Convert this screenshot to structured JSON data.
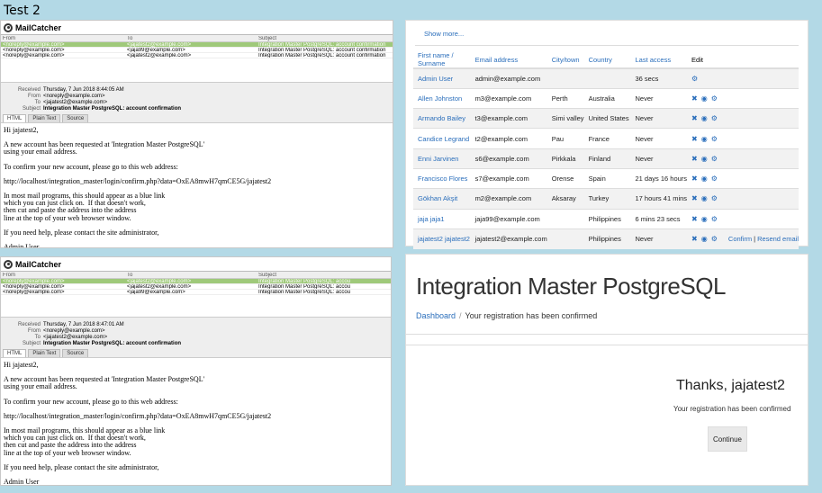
{
  "page_title": "Test 2",
  "mail1": {
    "app_name": "MailCatcher",
    "col_from": "From",
    "col_to": "To",
    "col_subject": "Subject",
    "rows": [
      {
        "from": "<noreply@example.com>",
        "to": "<jajatest2@example.com>",
        "subject": "Integration Master PostgreSQL: account confirmation",
        "selected": true
      },
      {
        "from": "<noreply@example.com>",
        "to": "<jaja99@example.com>",
        "subject": "Integration Master PostgreSQL: account confirmation",
        "selected": false
      },
      {
        "from": "<noreply@example.com>",
        "to": "<jajatest2@example.com>",
        "subject": "Integration Master PostgreSQL: account confirmation",
        "selected": false
      }
    ],
    "received_label": "Received",
    "received": "Thursday, 7 Jun 2018 8:44:05 AM",
    "from_label": "From",
    "from": "<noreply@example.com>",
    "to_label": "To",
    "to": "<jajatest2@example.com>",
    "subject_label": "Subject",
    "subject": "Integration Master PostgreSQL: account confirmation",
    "tabs": [
      "HTML",
      "Plain Text",
      "Source"
    ],
    "body": [
      "Hi jajatest2,",
      "A new account has been requested at 'Integration Master PostgreSQL'\nusing your email address.",
      "To confirm your new account, please go to this web address:",
      "http://localhost/integration_master/login/confirm.php?data=OxEA8mwH7qmCE5G/jajatest2",
      "In most mail programs, this should appear as a blue link\nwhich you can just click on.  If that doesn't work,\nthen cut and paste the address into the address\nline at the top of your web browser window.",
      "If you need help, please contact the site administrator,",
      "Admin User"
    ]
  },
  "mail2": {
    "app_name": "MailCatcher",
    "col_from": "From",
    "col_to": "To",
    "col_subject": "Subject",
    "rows": [
      {
        "from": "<noreply@example.com>",
        "to": "<jajatest2@example.com>",
        "subject": "Integration Master PostgreSQL: accou",
        "selected": true
      },
      {
        "from": "<noreply@example.com>",
        "to": "<jajatest2@example.com>",
        "subject": "Integration Master PostgreSQL: accou",
        "selected": false
      },
      {
        "from": "<noreply@example.com>",
        "to": "<jaja99@example.com>",
        "subject": "Integration Master PostgreSQL: accou",
        "selected": false
      }
    ],
    "received_label": "Received",
    "received": "Thursday, 7 Jun 2018 8:47:01 AM",
    "from_label": "From",
    "from": "<noreply@example.com>",
    "to_label": "To",
    "to": "<jajatest2@example.com>",
    "subject_label": "Subject",
    "subject": "Integration Master PostgreSQL: account confirmation",
    "tabs": [
      "HTML",
      "Plain Text",
      "Source"
    ],
    "body": [
      "Hi jajatest2,",
      "A new account has been requested at 'Integration Master PostgreSQL'\nusing your email address.",
      "To confirm your new account, please go to this web address:",
      "http://localhost/integration_master/login/confirm.php?data=OxEA8mwH7qmCE5G/jajatest2",
      "In most mail programs, this should appear as a blue link\nwhich you can just click on.  If that doesn't work,\nthen cut and paste the address into the address\nline at the top of your web browser window.",
      "If you need help, please contact the site administrator,",
      "Admin User"
    ]
  },
  "users": {
    "show_more": "Show more...",
    "headers": [
      "First name / Surname",
      "Email address",
      "City/town",
      "Country",
      "Last access",
      "Edit"
    ],
    "rows": [
      {
        "name": "Admin User",
        "email": "admin@example.com",
        "city": "",
        "country": "",
        "last": "36 secs",
        "icons": [
          "gear-icon"
        ],
        "extra": ""
      },
      {
        "name": "Allen Johnston",
        "email": "m3@example.com",
        "city": "Perth",
        "country": "Australia",
        "last": "Never",
        "icons": [
          "trash-icon",
          "eye-icon",
          "gear-icon"
        ],
        "extra": ""
      },
      {
        "name": "Armando Bailey",
        "email": "t3@example.com",
        "city": "Simi valley",
        "country": "United States",
        "last": "Never",
        "icons": [
          "trash-icon",
          "eye-icon",
          "gear-icon"
        ],
        "extra": ""
      },
      {
        "name": "Candice Legrand",
        "email": "t2@example.com",
        "city": "Pau",
        "country": "France",
        "last": "Never",
        "icons": [
          "trash-icon",
          "eye-icon",
          "gear-icon"
        ],
        "extra": ""
      },
      {
        "name": "Enni Jarvinen",
        "email": "s6@example.com",
        "city": "Pirkkala",
        "country": "Finland",
        "last": "Never",
        "icons": [
          "trash-icon",
          "eye-icon",
          "gear-icon"
        ],
        "extra": ""
      },
      {
        "name": "Francisco Flores",
        "email": "s7@example.com",
        "city": "Orense",
        "country": "Spain",
        "last": "21 days 16 hours",
        "icons": [
          "trash-icon",
          "eye-icon",
          "gear-icon"
        ],
        "extra": ""
      },
      {
        "name": "Gökhan Akşit",
        "email": "m2@example.com",
        "city": "Aksaray",
        "country": "Turkey",
        "last": "17 hours 41 mins",
        "icons": [
          "trash-icon",
          "eye-icon",
          "gear-icon"
        ],
        "extra": ""
      },
      {
        "name": "jaja jaja1",
        "email": "jaja99@example.com",
        "city": "",
        "country": "Philippines",
        "last": "6 mins 23 secs",
        "icons": [
          "trash-icon",
          "eye-icon",
          "gear-icon"
        ],
        "extra": ""
      },
      {
        "name": "jajatest2 jajatest2",
        "email": "jajatest2@example.com",
        "city": "",
        "country": "Philippines",
        "last": "Never",
        "icons": [
          "trash-icon",
          "eye-icon",
          "gear-icon"
        ],
        "extra": "Confirm | Resend email"
      }
    ],
    "confirm_label": "Confirm",
    "sep": "|",
    "resend_label": "Resend email"
  },
  "site": {
    "title": "Integration Master PostgreSQL",
    "crumb_home": "Dashboard",
    "crumb_sep": "/",
    "crumb_current": "Your registration has been confirmed",
    "thanks": "Thanks, jajatest2",
    "message": "Your registration has been confirmed",
    "continue_label": "Continue"
  }
}
